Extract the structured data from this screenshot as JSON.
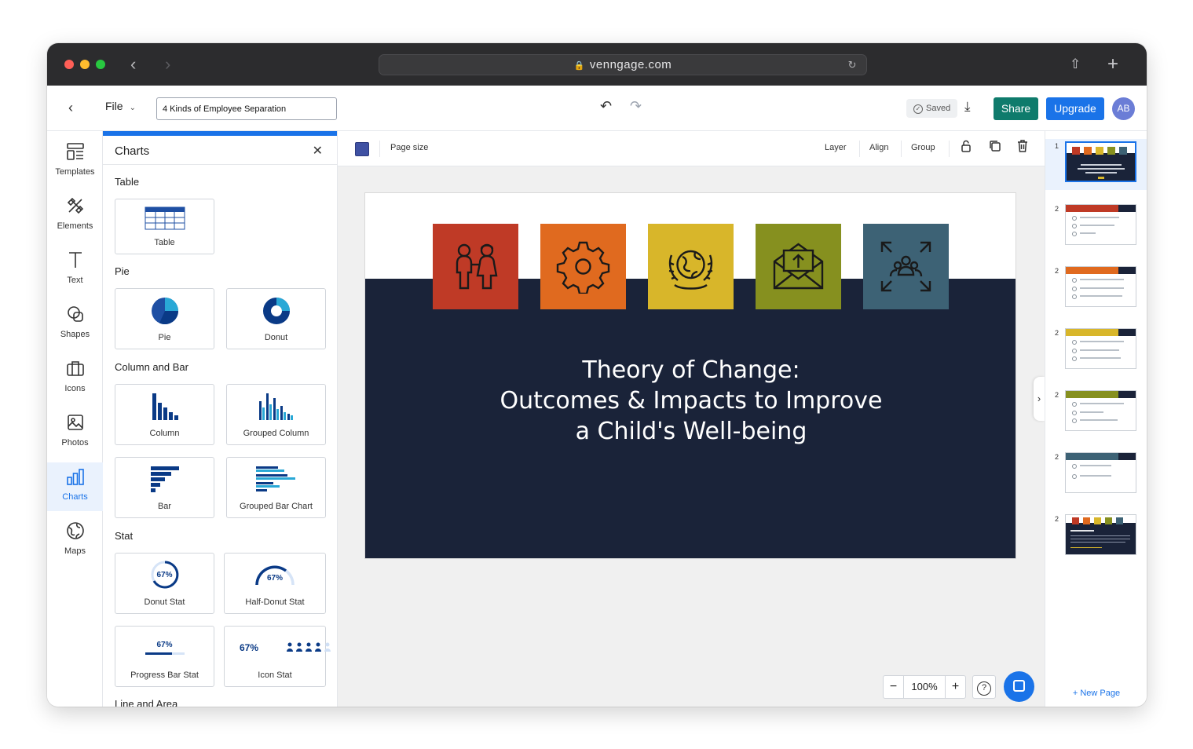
{
  "browser": {
    "url": "venngage.com"
  },
  "header": {
    "file_label": "File",
    "document_title": "4 Kinds of Employee Separation",
    "saved_label": "Saved",
    "share_label": "Share",
    "upgrade_label": "Upgrade",
    "avatar_initials": "AB"
  },
  "rail": {
    "items": [
      {
        "label": "Templates",
        "icon": "templates-icon"
      },
      {
        "label": "Elements",
        "icon": "elements-icon"
      },
      {
        "label": "Text",
        "icon": "text-icon"
      },
      {
        "label": "Shapes",
        "icon": "shapes-icon"
      },
      {
        "label": "Icons",
        "icon": "icons-icon"
      },
      {
        "label": "Photos",
        "icon": "photos-icon"
      },
      {
        "label": "Charts",
        "icon": "charts-icon",
        "active": true
      },
      {
        "label": "Maps",
        "icon": "maps-icon"
      }
    ]
  },
  "panel": {
    "title": "Charts",
    "sections": {
      "table": "Table",
      "pie": "Pie",
      "column_bar": "Column and Bar",
      "stat": "Stat",
      "line_area": "Line and Area"
    },
    "cards": {
      "table": "Table",
      "pie": "Pie",
      "donut": "Donut",
      "column": "Column",
      "grouped_column": "Grouped Column",
      "bar": "Bar",
      "grouped_bar": "Grouped Bar Chart",
      "donut_stat": "Donut Stat",
      "half_donut_stat": "Half-Donut Stat",
      "progress_bar_stat": "Progress Bar Stat",
      "icon_stat": "Icon Stat"
    },
    "stat_value": "67%"
  },
  "toolbar": {
    "page_size": "Page size",
    "layer": "Layer",
    "align": "Align",
    "group": "Group",
    "swatch_color": "#3f51a3"
  },
  "slide": {
    "title_line1": "Theory of Change:",
    "title_line2": "Outcomes & Impacts to Improve",
    "title_line3": "a Child's Well-being",
    "background": "#1a2339",
    "tiles": [
      {
        "icon": "children-icon",
        "color": "#bf3a26"
      },
      {
        "icon": "gear-icon",
        "color": "#e06a1f"
      },
      {
        "icon": "un-globe-icon",
        "color": "#d8b62a"
      },
      {
        "icon": "mail-upload-icon",
        "color": "#86901f"
      },
      {
        "icon": "people-converge-icon",
        "color": "#3d6275"
      }
    ]
  },
  "zoom": {
    "level": "100%"
  },
  "pages": {
    "items": [
      {
        "number": "1",
        "color": "#1a2339"
      },
      {
        "number": "2",
        "color": "#bf3a26"
      },
      {
        "number": "2",
        "color": "#e06a1f"
      },
      {
        "number": "2",
        "color": "#d8b62a"
      },
      {
        "number": "2",
        "color": "#86901f"
      },
      {
        "number": "2",
        "color": "#3d6275"
      },
      {
        "number": "2",
        "color": "#1a2339"
      }
    ],
    "new_page": "+ New Page"
  }
}
